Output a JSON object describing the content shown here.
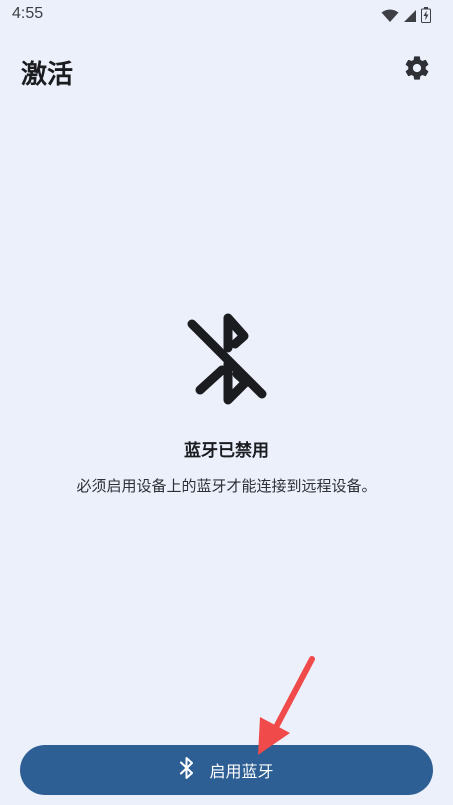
{
  "status_bar": {
    "time": "4:55",
    "icons": [
      "wifi-icon",
      "signal-icon",
      "battery-icon"
    ]
  },
  "app_bar": {
    "title": "激活",
    "settings_icon": "gear-icon"
  },
  "main": {
    "state_icon": "bluetooth-disabled-icon",
    "state_title": "蓝牙已禁用",
    "state_description": "必须启用设备上的蓝牙才能连接到远程设备。"
  },
  "action": {
    "icon": "bluetooth-icon",
    "label": "启用蓝牙",
    "color": "#2d5e94"
  },
  "colors": {
    "background": "#ebf0fa",
    "annotation_arrow": "#f04a4a"
  }
}
